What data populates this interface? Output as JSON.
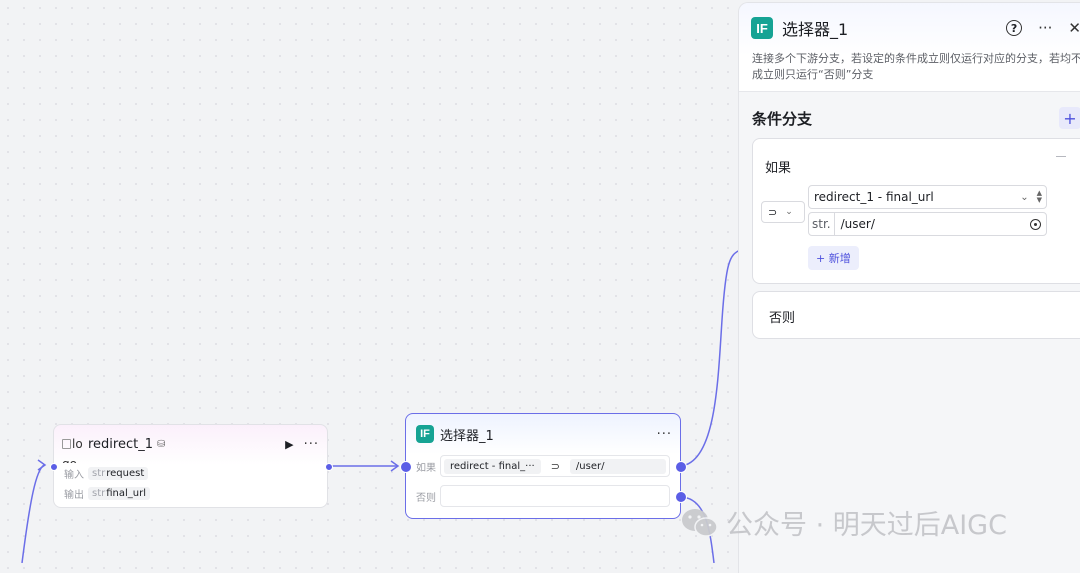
{
  "canvas": {
    "redirect_node": {
      "broken_image_alt": "lo",
      "title": "redirect_1",
      "overflow_text": "go",
      "input_label": "输入",
      "input_type": "str",
      "input_name": "request",
      "output_label": "输出",
      "output_type": "str",
      "output_name": "final_url",
      "more_label": "···",
      "run_label": "▶"
    },
    "selector_node": {
      "badge": "IF",
      "title": "选择器_1",
      "more_label": "···",
      "if_label": "如果",
      "if_variable": "redirect  -  final_···",
      "if_operator": "⊃",
      "if_value": "/user/",
      "else_label": "否则"
    }
  },
  "panel": {
    "badge": "IF",
    "title": "选择器_1",
    "help_icon": "?",
    "more_label": "···",
    "close_label": "✕",
    "description": "连接多个下游分支，若设定的条件成立则仅运行对应的分支，若均不成立则只运行“否则”分支",
    "section_title": "条件分支",
    "add_branch_label": "+",
    "if_branch": {
      "label": "如果",
      "operator": "⊃",
      "variable": "redirect_1 - final_url",
      "value_type": "str.",
      "value": "/user/",
      "add_condition_label": "+ 新增"
    },
    "else_branch": {
      "label": "否则"
    }
  },
  "watermark": {
    "text": "公众号 · 明天过后AIGC"
  },
  "colors": {
    "accent": "#5b5ee6",
    "if_badge": "#16a394",
    "canvas_bg": "#f2f3f5"
  }
}
